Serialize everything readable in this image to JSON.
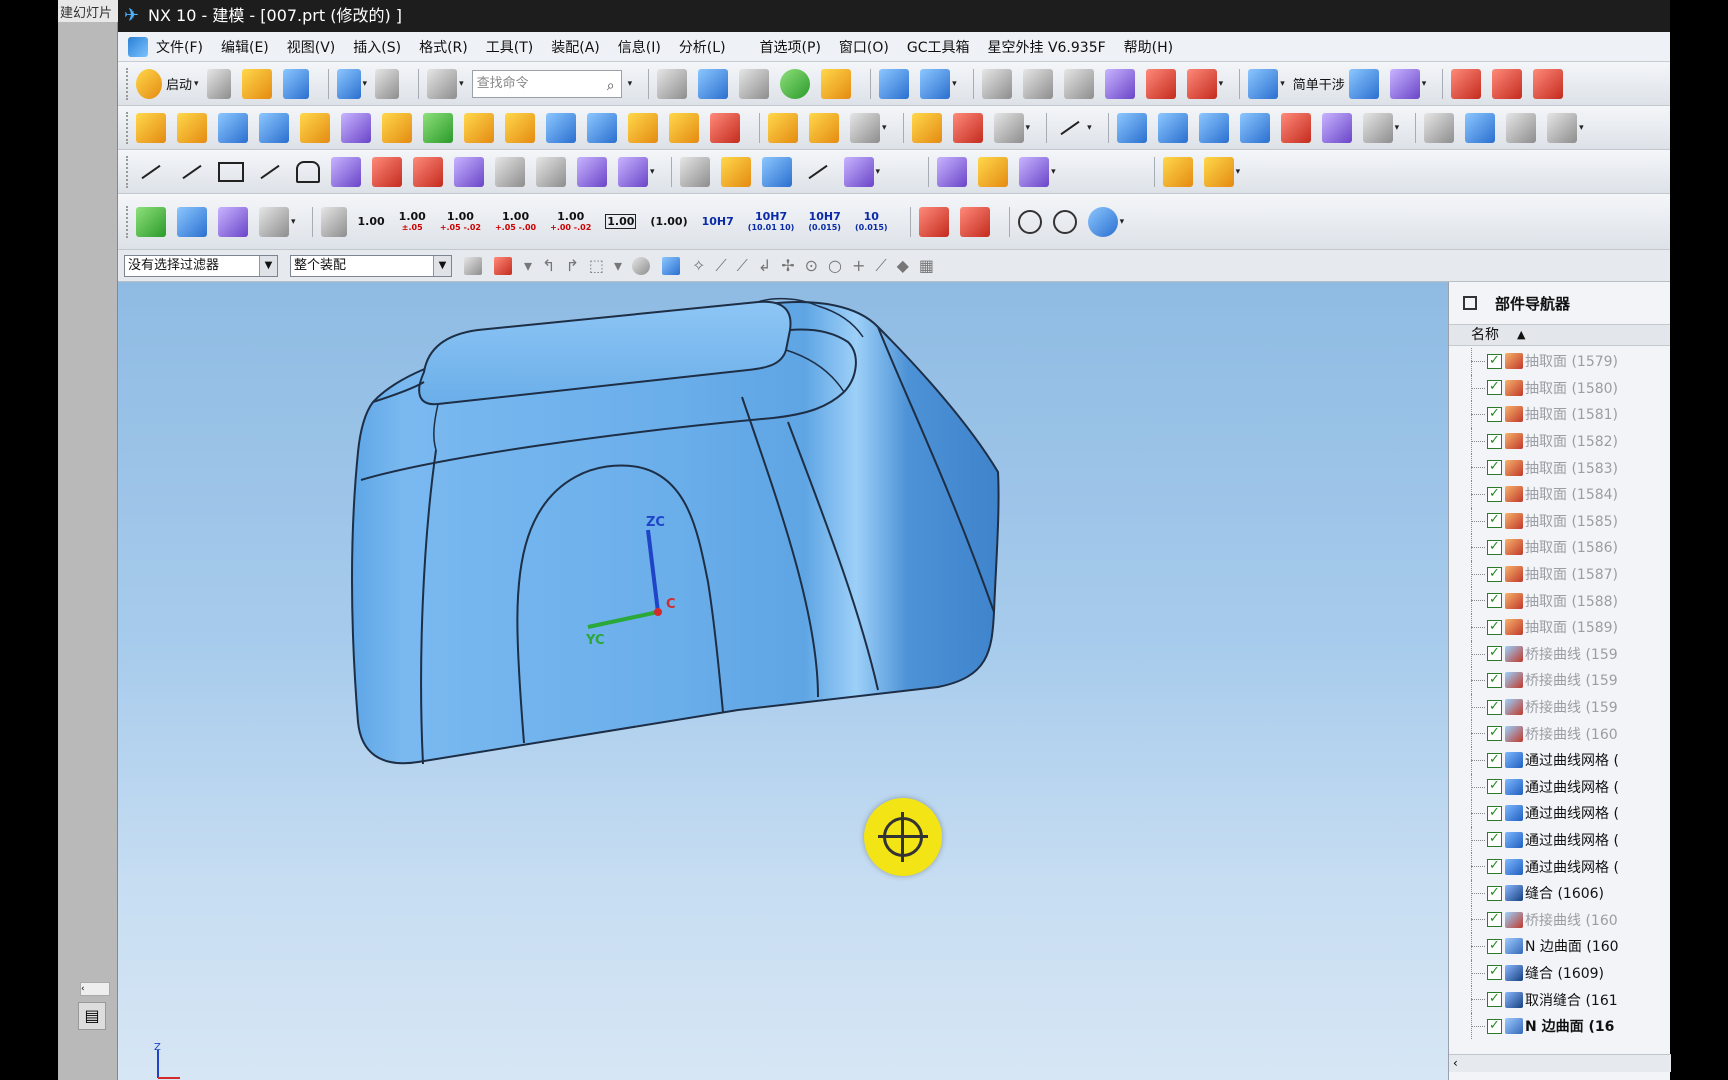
{
  "left_strip": {
    "title_fragment": "建幻灯片"
  },
  "window": {
    "title": "NX 10 - 建模 - [007.prt  (修改的) ]"
  },
  "menu": [
    "文件(F)",
    "编辑(E)",
    "视图(V)",
    "插入(S)",
    "格式(R)",
    "工具(T)",
    "装配(A)",
    "信息(I)",
    "分析(L)",
    "首选项(P)",
    "窗口(O)",
    "GC工具箱",
    "星空外挂 V6.935F",
    "帮助(H)"
  ],
  "toolbar1": {
    "start_label": "启动",
    "search_placeholder": "查找命令",
    "simple_interference": "简单干涉"
  },
  "toolbar4": {
    "tolerances": [
      {
        "main": "1.00",
        "sub": ""
      },
      {
        "main": "1.00",
        "sub": "±.05"
      },
      {
        "main": "1.00",
        "sub": "+.05 -.02"
      },
      {
        "main": "1.00",
        "sub": "+.05 -.00"
      },
      {
        "main": "1.00",
        "sub": "+.00 -.02"
      },
      {
        "main": "1.00",
        "sub": ""
      },
      {
        "main": "(1.00)",
        "sub": ""
      },
      {
        "main": "10H7",
        "sub": ""
      },
      {
        "main": "10H7",
        "sub": "(10.01 10)"
      },
      {
        "main": "10H7",
        "sub": "(0.015)"
      },
      {
        "main": "10",
        "sub": "(0.015)"
      }
    ]
  },
  "filterbar": {
    "type_filter": "没有选择过滤器",
    "scope": "整个装配"
  },
  "viewport": {
    "axis_z": "ZC",
    "axis_y": "YC",
    "axis_x": "C",
    "triad_z": "Z"
  },
  "navigator": {
    "title": "部件导航器",
    "column": "名称",
    "rows": [
      {
        "icon": "extract",
        "label": "抽取面 (1579)",
        "dim": true
      },
      {
        "icon": "extract",
        "label": "抽取面 (1580)",
        "dim": true
      },
      {
        "icon": "extract",
        "label": "抽取面 (1581)",
        "dim": true
      },
      {
        "icon": "extract",
        "label": "抽取面 (1582)",
        "dim": true
      },
      {
        "icon": "extract",
        "label": "抽取面 (1583)",
        "dim": true
      },
      {
        "icon": "extract",
        "label": "抽取面 (1584)",
        "dim": true
      },
      {
        "icon": "extract",
        "label": "抽取面 (1585)",
        "dim": true
      },
      {
        "icon": "extract",
        "label": "抽取面 (1586)",
        "dim": true
      },
      {
        "icon": "extract",
        "label": "抽取面 (1587)",
        "dim": true
      },
      {
        "icon": "extract",
        "label": "抽取面 (1588)",
        "dim": true
      },
      {
        "icon": "extract",
        "label": "抽取面 (1589)",
        "dim": true
      },
      {
        "icon": "bridge",
        "label": "桥接曲线 (159",
        "dim": true
      },
      {
        "icon": "bridge",
        "label": "桥接曲线 (159",
        "dim": true
      },
      {
        "icon": "bridge",
        "label": "桥接曲线 (159",
        "dim": true
      },
      {
        "icon": "bridge",
        "label": "桥接曲线 (160",
        "dim": true
      },
      {
        "icon": "mesh",
        "label": "通过曲线网格 (",
        "dim": false
      },
      {
        "icon": "mesh",
        "label": "通过曲线网格 (",
        "dim": false
      },
      {
        "icon": "mesh",
        "label": "通过曲线网格 (",
        "dim": false
      },
      {
        "icon": "mesh",
        "label": "通过曲线网格 (",
        "dim": false
      },
      {
        "icon": "mesh",
        "label": "通过曲线网格 (",
        "dim": false
      },
      {
        "icon": "sew",
        "label": "缝合 (1606)",
        "dim": false
      },
      {
        "icon": "bridge",
        "label": "桥接曲线 (160",
        "dim": true
      },
      {
        "icon": "nside",
        "label": "N 边曲面 (160",
        "dim": false
      },
      {
        "icon": "sew",
        "label": "缝合 (1609)",
        "dim": false
      },
      {
        "icon": "sew",
        "label": "取消缝合 (161",
        "dim": false
      },
      {
        "icon": "nside",
        "label": "N 边曲面 (16",
        "dim": false,
        "bold": true
      }
    ]
  }
}
